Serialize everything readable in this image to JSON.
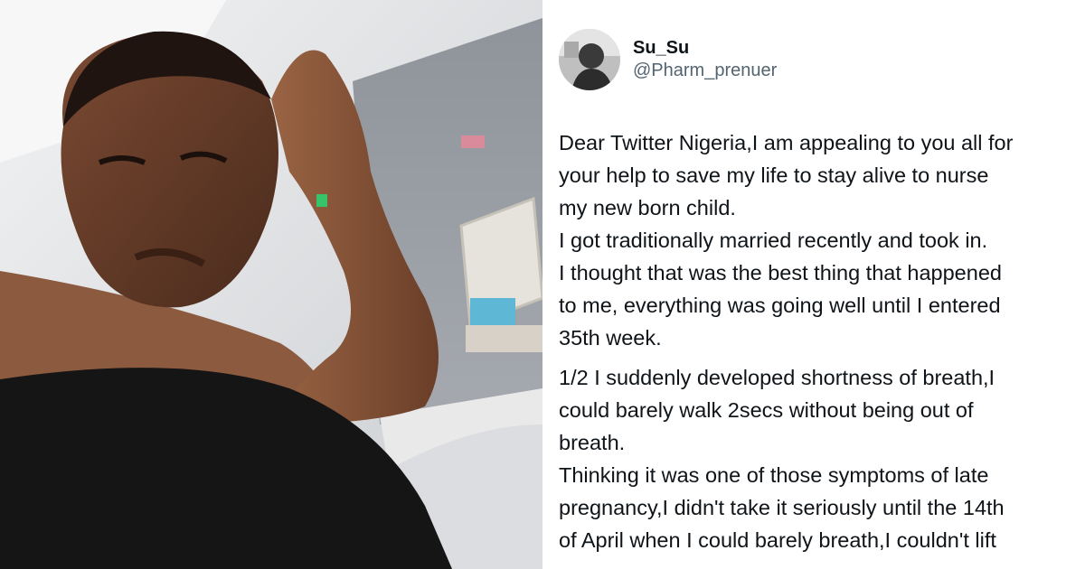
{
  "photo": {
    "icon": "selfie-photo"
  },
  "tweet": {
    "author": {
      "display_name": "Su_Su",
      "handle": "@Pharm_prenuer",
      "avatar_icon": "avatar-photo"
    },
    "lines": [
      "Dear Twitter Nigeria,I am appealing to you all for",
      "your help to save my life to stay alive to nurse",
      "my new born child.",
      "I got traditionally married recently and took in.",
      "I thought that was the best thing that happened",
      "to me, everything was going well until I entered",
      "35th week.",
      "1/2 I suddenly developed shortness of breath,I",
      "could barely walk 2secs without being out of",
      "breath.",
      "Thinking it was one of those symptoms of late",
      "pregnancy,I didn't take it seriously until the 14th",
      "of April when I could barely breath,I couldn't lift"
    ]
  }
}
